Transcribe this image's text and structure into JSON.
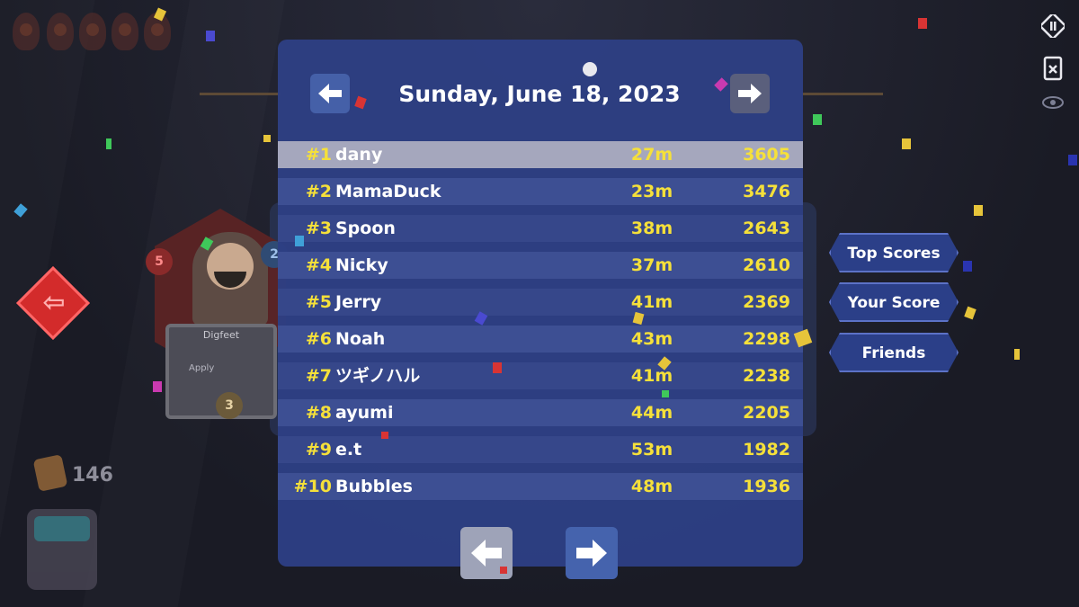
{
  "header": {
    "date": "Sunday, June 18, 2023"
  },
  "leaderboard": [
    {
      "rank": "#1",
      "name": "dany",
      "time": "27m",
      "score": "3605"
    },
    {
      "rank": "#2",
      "name": "MamaDuck",
      "time": "23m",
      "score": "3476"
    },
    {
      "rank": "#3",
      "name": "Spoon",
      "time": "38m",
      "score": "2643"
    },
    {
      "rank": "#4",
      "name": "Nicky",
      "time": "37m",
      "score": "2610"
    },
    {
      "rank": "#5",
      "name": "Jerry",
      "time": "41m",
      "score": "2369"
    },
    {
      "rank": "#6",
      "name": "Noah",
      "time": "43m",
      "score": "2298"
    },
    {
      "rank": "#7",
      "name": "ツギノハル",
      "time": "41m",
      "score": "2238"
    },
    {
      "rank": "#8",
      "name": "ayumi",
      "time": "44m",
      "score": "2205"
    },
    {
      "rank": "#9",
      "name": "e.t",
      "time": "53m",
      "score": "1982"
    },
    {
      "rank": "#10",
      "name": "Bubbles",
      "time": "48m",
      "score": "1936"
    }
  ],
  "side_menu": {
    "top_scores": "Top Scores",
    "your_score": "Your Score",
    "friends": "Friends"
  },
  "hud": {
    "coins": "146"
  },
  "character_card": {
    "name": "Digfeet",
    "apply_label": "Apply",
    "level_left": "5",
    "level_right": "2",
    "level_bottom": "3"
  },
  "icons": {
    "date_prev": "arrow-left-icon",
    "date_next": "arrow-right-icon",
    "page_prev": "arrow-left-icon",
    "page_next": "arrow-right-icon",
    "pause": "pause-icon",
    "deck": "card-deck-icon",
    "view": "eye-icon",
    "back": "back-arrow-icon"
  },
  "colors": {
    "panel": "#2d3f83",
    "row_dark": "#36478a",
    "row_light": "#3d4f93",
    "row_highlight": "#a5a7bd",
    "accent_yellow": "#f5e03a",
    "back_button": "#d32b2b"
  }
}
